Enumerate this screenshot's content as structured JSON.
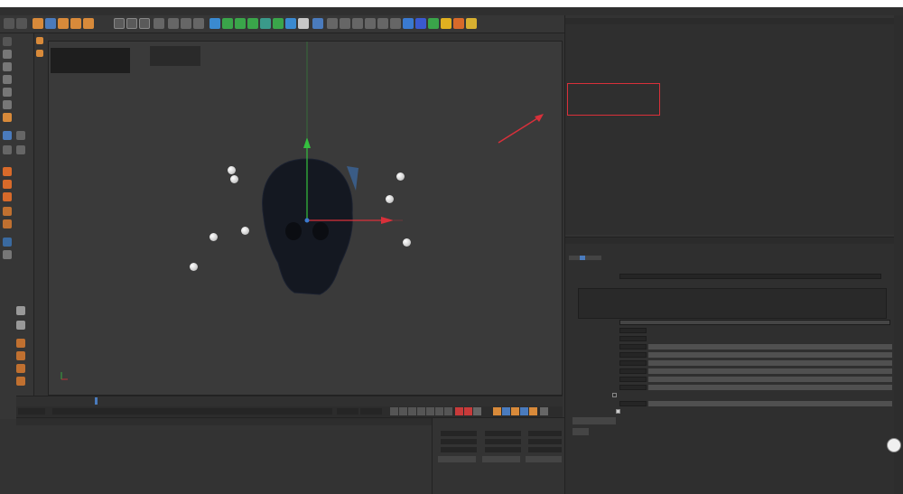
{
  "titlebar": {
    "title": "",
    "controls": [
      "",
      "",
      ""
    ]
  },
  "menubar": {
    "items": [
      "",
      "",
      "",
      "",
      "",
      "",
      "",
      "",
      "",
      "",
      "",
      "",
      "",
      "",
      "",
      "",
      "",
      "",
      "",
      "",
      "",
      ""
    ],
    "right_items": [
      "",
      "",
      "",
      ""
    ]
  },
  "viewport": {
    "menu": [
      "",
      "",
      "",
      "",
      "",
      "",
      "",
      "",
      ""
    ],
    "info_lines": [
      "",
      "",
      ""
    ],
    "hud_lines": [
      "",
      ""
    ],
    "footer_left": "",
    "footer_right": ""
  },
  "timeline": {
    "ticks": [
      "",
      "",
      "",
      "",
      "",
      "",
      "",
      "",
      "",
      "",
      "",
      "",
      "",
      "",
      "",
      "",
      "",
      "",
      "",
      "",
      "",
      "",
      "",
      "",
      "",
      ""
    ],
    "current_frame": "",
    "start_field": "",
    "min_field": "",
    "max_field": "",
    "end_field": ""
  },
  "bottom": {
    "menu": [
      "",
      "",
      "",
      "",
      "",
      "",
      "",
      "",
      ""
    ]
  },
  "coords": {
    "headers": [
      "",
      "",
      ""
    ],
    "rows": [
      {
        "axis": "",
        "pos": "",
        "size_axis": "",
        "size": "",
        "rot_axis": "",
        "rot": ""
      },
      {
        "axis": "",
        "pos": "",
        "size_axis": "",
        "size": "",
        "rot_axis": "",
        "rot": ""
      },
      {
        "axis": "",
        "pos": "",
        "size_axis": "",
        "size": "",
        "rot_axis": "",
        "rot": ""
      }
    ],
    "mode_select": "",
    "size_select": "",
    "apply_label": ""
  },
  "object_manager": {
    "menu": [
      "",
      "",
      "",
      "",
      "",
      "",
      ""
    ],
    "objects": [
      "",
      "",
      "",
      "",
      "",
      "",
      "",
      "",
      "",
      "",
      "",
      "",
      "",
      "",
      "",
      "",
      ""
    ]
  },
  "attribute_manager": {
    "menu": [
      "",
      "",
      ""
    ],
    "object_name": "",
    "tabs": [
      "",
      "",
      "",
      "",
      "",
      ""
    ],
    "section_title": "",
    "scene_label": "",
    "scene_value": "",
    "links_label": "",
    "params": [
      {
        "label": "",
        "value": "",
        "slider": 0
      },
      {
        "label": "",
        "value": "",
        "slider": 0
      },
      {
        "label": "",
        "value": "",
        "slider": 0
      },
      {
        "label": "",
        "value": "",
        "slider": 0
      },
      {
        "label": "",
        "value": "",
        "slider": 0
      },
      {
        "label": "",
        "value": "",
        "slider": 0
      },
      {
        "label": "",
        "value": "",
        "slider": 0
      },
      {
        "label": "",
        "value": "",
        "slider": 0
      },
      {
        "label": "",
        "value": "",
        "slider": 0
      },
      {
        "label": "",
        "value": "",
        "slider": 0
      },
      {
        "label": "",
        "value": "",
        "slider": 0
      },
      {
        "label": "",
        "value": "",
        "slider": 0
      },
      {
        "label": "",
        "value": "",
        "slider": 0
      },
      {
        "label": "",
        "value": "",
        "slider": 0
      }
    ],
    "create_state_button": "",
    "help_button": ""
  },
  "colors": {
    "accent": "#4a7bbd",
    "annotation": "#d9303a",
    "highlight": "#e8a33a"
  }
}
